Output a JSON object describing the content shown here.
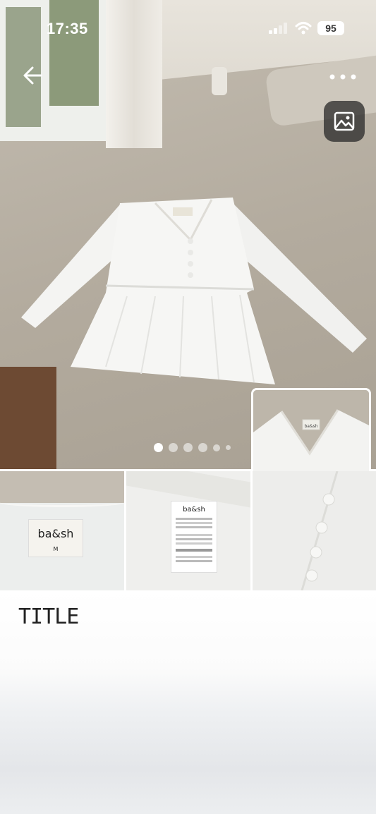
{
  "status_bar": {
    "time": "17:35",
    "battery": "95"
  },
  "nav": {
    "back_icon": "arrow-left-icon",
    "more_icon": "more-horizontal-icon",
    "gallery_icon": "image-icon"
  },
  "carousel": {
    "active_index": 0,
    "dot_count": 6
  },
  "thumbnails": {
    "label_brand": "ba&sh",
    "label_size": "M"
  },
  "title": "TITLE"
}
